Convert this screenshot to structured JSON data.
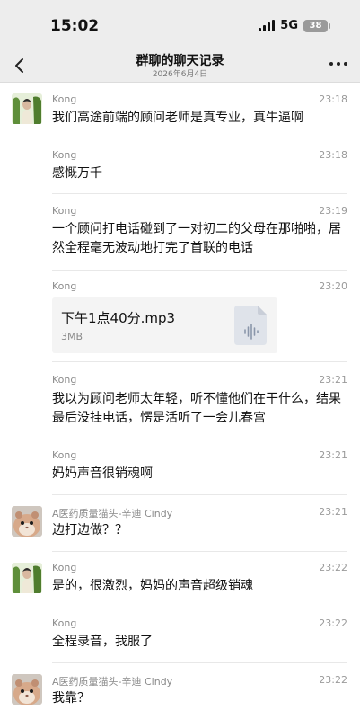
{
  "status": {
    "time": "15:02",
    "network": "5G",
    "battery": "38"
  },
  "nav": {
    "title": "群聊的聊天记录",
    "subtitle": "2026年6月4日",
    "back_icon": "chevron-left-icon",
    "more_icon": "more-horizontal-icon"
  },
  "messages": [
    {
      "sender": "Kong",
      "time": "23:18",
      "text": "我们高途前端的顾问老师是真专业，真牛逼啊",
      "avatar": "kong"
    },
    {
      "sender": "Kong",
      "time": "23:18",
      "text": "感慨万千"
    },
    {
      "sender": "Kong",
      "time": "23:19",
      "text": "一个顾问打电话碰到了一对初二的父母在那啪啪，居然全程毫无波动地打完了首联的电话"
    },
    {
      "sender": "Kong",
      "time": "23:20",
      "file": {
        "name": "下午1点40分.mp3",
        "size": "3MB",
        "icon": "audio-file-icon"
      }
    },
    {
      "sender": "Kong",
      "time": "23:21",
      "text": "我以为顾问老师太年轻，听不懂他们在干什么，结果最后没挂电话，愣是活听了一会儿春宫"
    },
    {
      "sender": "Kong",
      "time": "23:21",
      "text": "妈妈声音很销魂啊"
    },
    {
      "sender": "A医药质量猫头-辛迪 Cindy",
      "time": "23:21",
      "text": "边打边做？？",
      "avatar": "hamster"
    },
    {
      "sender": "Kong",
      "time": "23:22",
      "text": "是的，很激烈，妈妈的声音超级销魂",
      "avatar": "kong"
    },
    {
      "sender": "Kong",
      "time": "23:22",
      "text": "全程录音，我服了"
    },
    {
      "sender": "A医药质量猫头-辛迪 Cindy",
      "time": "23:22",
      "text": "我靠？",
      "avatar": "hamster"
    }
  ]
}
